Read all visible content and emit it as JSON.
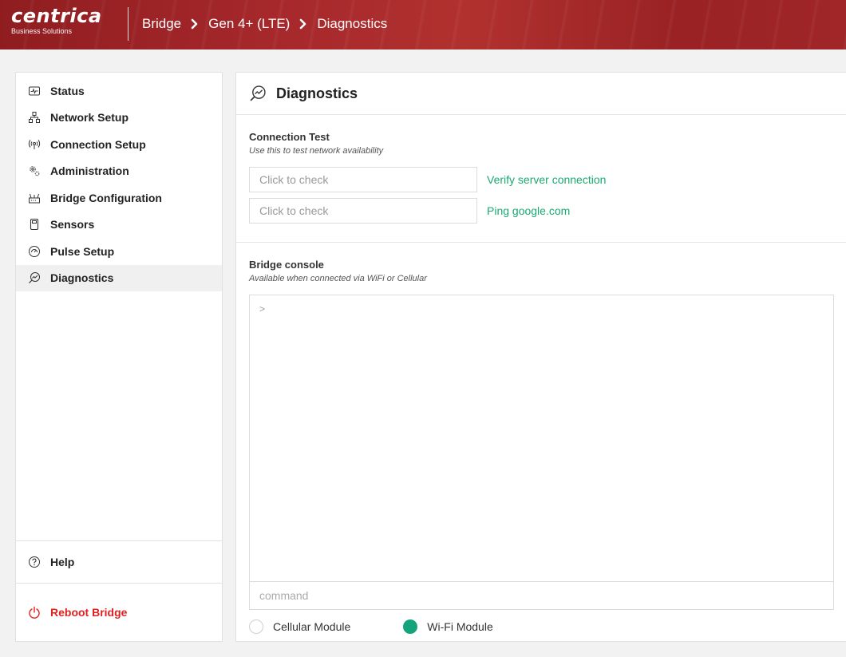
{
  "brand": {
    "name": "centrica",
    "subtitle": "Business Solutions"
  },
  "breadcrumb": [
    "Bridge",
    "Gen 4+ (LTE)",
    "Diagnostics"
  ],
  "sidebar": {
    "items": [
      {
        "label": "Status",
        "icon": "status-icon"
      },
      {
        "label": "Network Setup",
        "icon": "network-icon"
      },
      {
        "label": "Connection Setup",
        "icon": "antenna-icon"
      },
      {
        "label": "Administration",
        "icon": "gears-icon"
      },
      {
        "label": "Bridge Configuration",
        "icon": "router-icon"
      },
      {
        "label": "Sensors",
        "icon": "sensor-icon"
      },
      {
        "label": "Pulse Setup",
        "icon": "gauge-icon"
      },
      {
        "label": "Diagnostics",
        "icon": "diagnostics-icon",
        "active": true
      }
    ],
    "help": "Help",
    "reboot": "Reboot Bridge"
  },
  "main": {
    "title": "Diagnostics",
    "connection_test": {
      "title": "Connection Test",
      "subtitle": "Use this to test network availability",
      "checks": [
        {
          "placeholder": "Click to check",
          "action": "Verify server connection"
        },
        {
          "placeholder": "Click to check",
          "action": "Ping google.com"
        }
      ]
    },
    "console": {
      "title": "Bridge console",
      "subtitle": "Available when connected via WiFi or Cellular",
      "prompt": ">",
      "input_placeholder": "command",
      "modules": [
        {
          "label": "Cellular Module",
          "selected": false
        },
        {
          "label": "Wi-Fi Module",
          "selected": true
        }
      ]
    }
  },
  "colors": {
    "header": "#a8292c",
    "accent_green": "#1aaa72",
    "reboot_red": "#e02020"
  }
}
